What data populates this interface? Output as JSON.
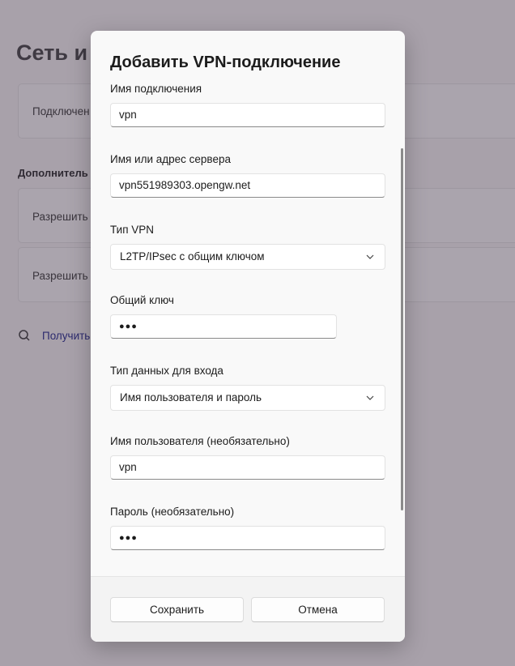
{
  "background": {
    "title": "Сеть и",
    "card1_label": "Подключен",
    "section_label": "Дополнитель",
    "card2_label": "Разрешить",
    "card3_label": "Разрешить",
    "link_label": "Получить"
  },
  "dialog": {
    "title": "Добавить VPN-подключение",
    "connection_name": {
      "label": "Имя подключения",
      "value": "vpn"
    },
    "server": {
      "label": "Имя или адрес сервера",
      "value": "vpn551989303.opengw.net"
    },
    "vpn_type": {
      "label": "Тип VPN",
      "value": "L2TP/IPsec с общим ключом"
    },
    "shared_key": {
      "label": "Общий ключ",
      "value": "●●●"
    },
    "signin_type": {
      "label": "Тип данных для входа",
      "value": "Имя пользователя и пароль"
    },
    "username": {
      "label": "Имя пользователя (необязательно)",
      "value": "vpn"
    },
    "password": {
      "label": "Пароль (необязательно)",
      "value": "●●●"
    },
    "save_label": "Сохранить",
    "cancel_label": "Отмена"
  },
  "icons": {
    "chevron": "chevron-down-icon",
    "link_icon": "search-shield-icon"
  }
}
